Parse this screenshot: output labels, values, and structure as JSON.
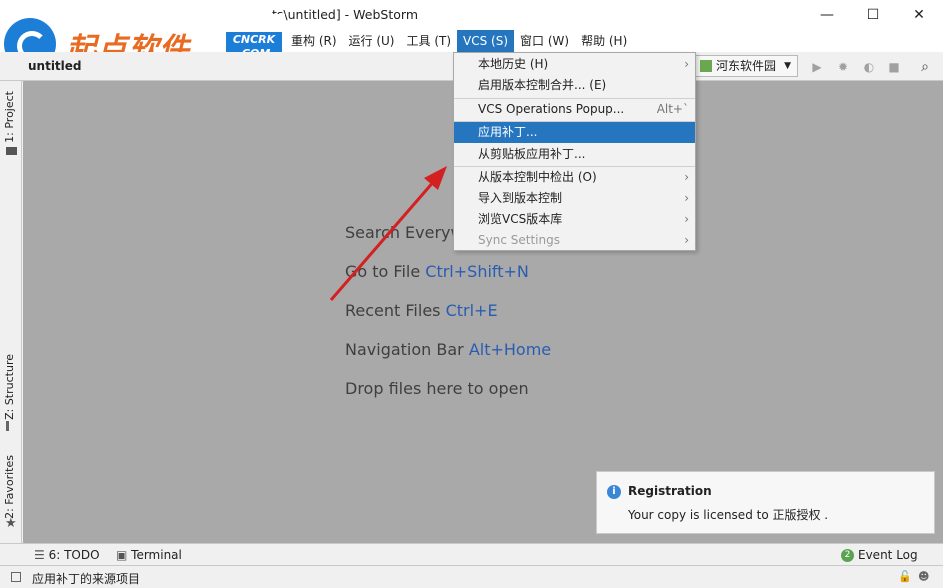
{
  "window": {
    "title": "ts\\untitled] - WebStorm",
    "minimize": "—",
    "maximize": "☐",
    "close": "✕"
  },
  "watermark": {
    "text": "起点软件",
    "badge_line1": "CNCRK",
    "badge_line2": ".COM"
  },
  "menubar": {
    "items": [
      "重构 (R)",
      "运行 (U)",
      "工具 (T)",
      "VCS (S)",
      "窗口 (W)",
      "帮助 (H)"
    ]
  },
  "navbar": {
    "project_name": "untitled",
    "run_config": "河东软件园"
  },
  "left_tabs": {
    "project": "1: Project",
    "structure": "Z: Structure",
    "favorites": "2: Favorites"
  },
  "editor_hints": [
    {
      "text": "Search Everyw",
      "key": ""
    },
    {
      "text": "Go to File ",
      "key": "Ctrl+Shift+N"
    },
    {
      "text": "Recent Files ",
      "key": "Ctrl+E"
    },
    {
      "text": "Navigation Bar ",
      "key": "Alt+Home"
    },
    {
      "text": "Drop files here to open",
      "key": ""
    }
  ],
  "vcs_menu": {
    "items": [
      {
        "label": "本地历史 (H)",
        "right": "›",
        "state": "normal"
      },
      {
        "label": "启用版本控制合并... (E)",
        "right": "",
        "state": "normal"
      },
      {
        "label": "VCS Operations Popup...",
        "right": "Alt+`",
        "state": "normal"
      },
      {
        "label": "应用补丁...",
        "right": "",
        "state": "selected"
      },
      {
        "label": "从剪贴板应用补丁...",
        "right": "",
        "state": "normal"
      },
      {
        "label": "从版本控制中检出 (O)",
        "right": "›",
        "state": "normal"
      },
      {
        "label": "导入到版本控制",
        "right": "›",
        "state": "normal"
      },
      {
        "label": "浏览VCS版本库",
        "right": "›",
        "state": "normal"
      },
      {
        "label": "Sync Settings",
        "right": "›",
        "state": "disabled"
      }
    ]
  },
  "bottom_tabs": {
    "todo": "6: TODO",
    "terminal": "Terminal",
    "event_log": "Event Log",
    "event_count": "2"
  },
  "notification": {
    "title": "Registration",
    "body": "Your copy is licensed to 正版授权 ."
  },
  "status": {
    "text": "应用补丁的来源项目"
  },
  "colors": {
    "accent": "#2675bf",
    "editor_bg": "#a9a9a9",
    "link_key": "#2a5db0",
    "arrow": "#d42020"
  }
}
